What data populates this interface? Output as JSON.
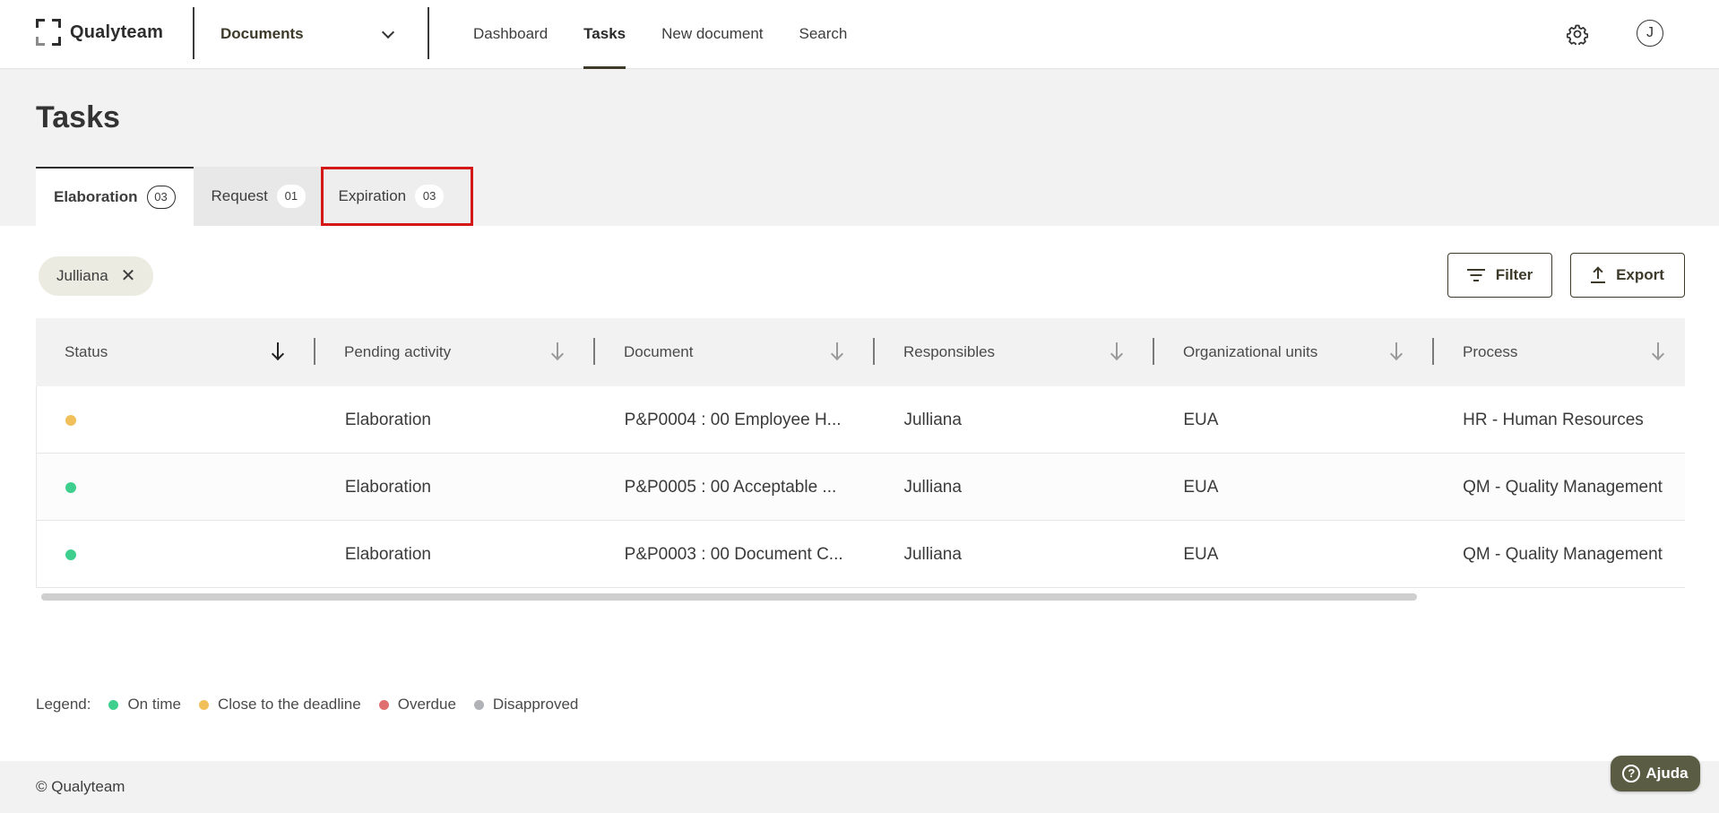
{
  "app": {
    "brand": "Qualyteam",
    "module": "Documents"
  },
  "nav": {
    "items": [
      "Dashboard",
      "Tasks",
      "New document",
      "Search"
    ],
    "active": "Tasks"
  },
  "user": {
    "initial": "J"
  },
  "page": {
    "title": "Tasks"
  },
  "tabs": [
    {
      "label": "Elaboration",
      "count": "03",
      "active": true
    },
    {
      "label": "Request",
      "count": "01",
      "active": false
    },
    {
      "label": "Expiration",
      "count": "03",
      "active": false,
      "highlighted": true
    }
  ],
  "filters": {
    "chip_label": "Julliana",
    "filter_label": "Filter",
    "export_label": "Export"
  },
  "table": {
    "columns": [
      "Status",
      "Pending activity",
      "Document",
      "Responsibles",
      "Organizational units",
      "Process"
    ],
    "rows": [
      {
        "status_color": "#f2c05a",
        "activity": "Elaboration",
        "document": "P&P0004 : 00 Employee H...",
        "responsibles": "Julliana",
        "org_unit": "EUA",
        "process": "HR - Human Resources"
      },
      {
        "status_color": "#3ecf8e",
        "activity": "Elaboration",
        "document": "P&P0005 : 00 Acceptable ...",
        "responsibles": "Julliana",
        "org_unit": "EUA",
        "process": "QM - Quality Management"
      },
      {
        "status_color": "#3ecf8e",
        "activity": "Elaboration",
        "document": "P&P0003 : 00 Document C...",
        "responsibles": "Julliana",
        "org_unit": "EUA",
        "process": "QM - Quality Management"
      }
    ]
  },
  "legend": {
    "label": "Legend:",
    "items": [
      {
        "label": "On time",
        "color": "#3ecf8e"
      },
      {
        "label": "Close to the deadline",
        "color": "#f2c05a"
      },
      {
        "label": "Overdue",
        "color": "#e07070"
      },
      {
        "label": "Disapproved",
        "color": "#b0b2b8"
      }
    ]
  },
  "footer": {
    "copyright": "© Qualyteam"
  },
  "help": {
    "label": "Ajuda"
  },
  "icons": {
    "settings": "gear-icon",
    "module_dropdown": "chevron-down-icon",
    "chip_remove": "close-icon",
    "filter": "filter-icon",
    "export": "upload-icon",
    "help": "question-icon"
  }
}
